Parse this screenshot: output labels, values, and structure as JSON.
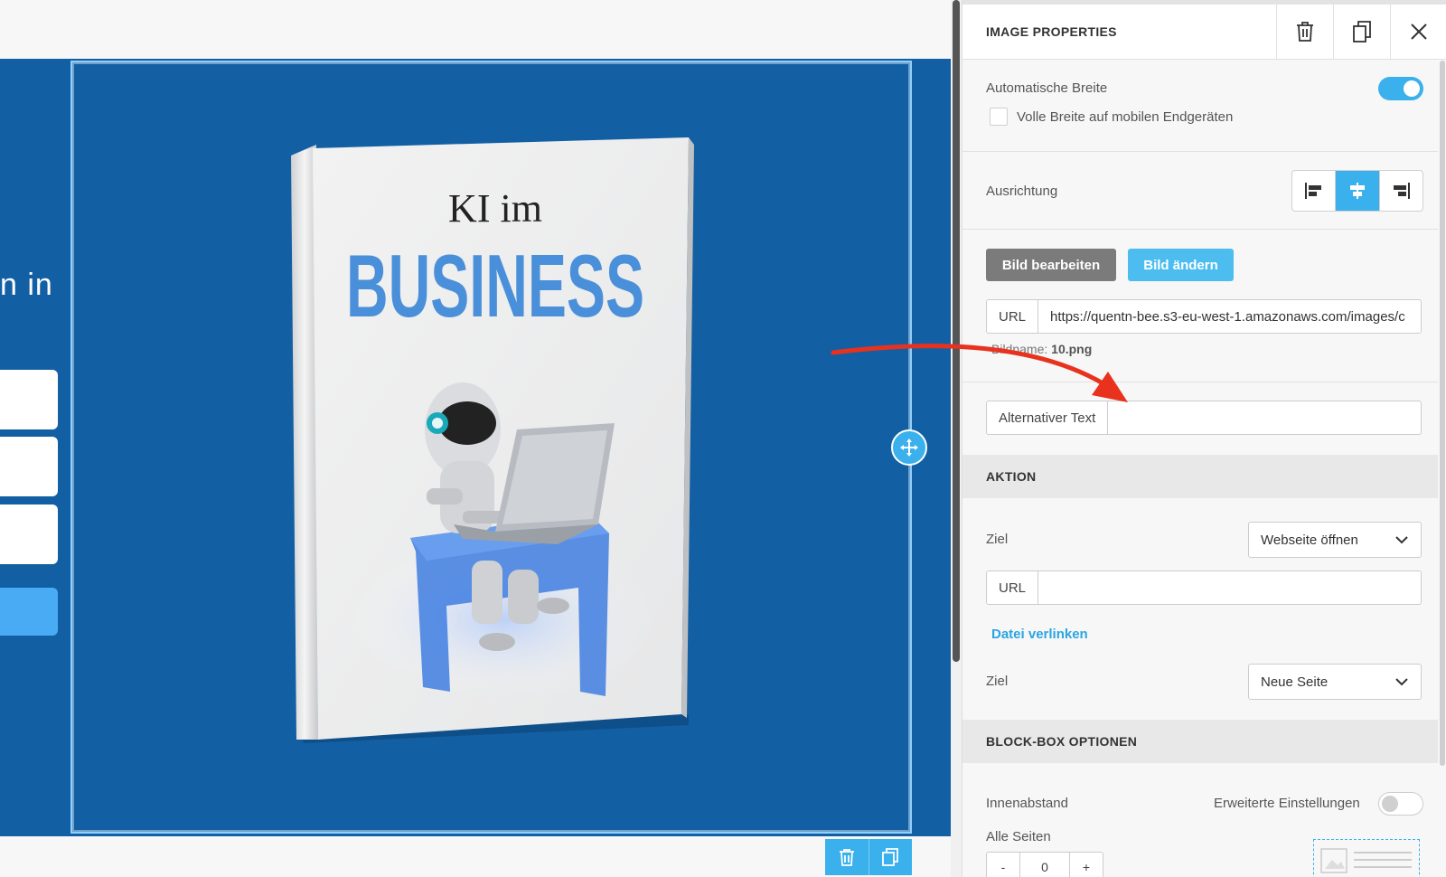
{
  "canvas": {
    "partial_heading": "n in",
    "book": {
      "title_line1": "KI im",
      "title_line2": "BUSINESS"
    }
  },
  "panel": {
    "title": "IMAGE PROPERTIES",
    "header_icons": [
      "trash-icon",
      "copy-icon",
      "close-icon"
    ],
    "auto_width_label": "Automatische Breite",
    "auto_width_on": true,
    "full_width_mobile_label": "Volle Breite auf mobilen Endgeräten",
    "alignment_label": "Ausrichtung",
    "alignment_selected": "center",
    "edit_image_label": "Bild bearbeiten",
    "change_image_label": "Bild ändern",
    "url_addon": "URL",
    "image_url": "https://quentn-bee.s3-eu-west-1.amazonaws.com/images/c",
    "image_name_label": "Bildname:",
    "image_name": "10.png",
    "alt_text_label": "Alternativer Text",
    "alt_text_value": "",
    "action_section": "AKTION",
    "target_label": "Ziel",
    "target_value": "Webseite öffnen",
    "link_url_addon": "URL",
    "link_url_value": "",
    "link_file_label": "Datei verlinken",
    "target2_label": "Ziel",
    "target2_value": "Neue Seite",
    "blockbox_section": "BLOCK-BOX OPTIONEN",
    "padding_label": "Innenabstand",
    "advanced_label": "Erweiterte Einstellungen",
    "advanced_on": false,
    "all_sides_label": "Alle Seiten",
    "stepper_minus": "-",
    "stepper_value": "0",
    "stepper_plus": "+"
  },
  "colors": {
    "accent": "#3ab0ec",
    "canvas_blue": "#135fa3",
    "arrow_red": "#e8321e",
    "book_blue": "#4a8fd9"
  }
}
